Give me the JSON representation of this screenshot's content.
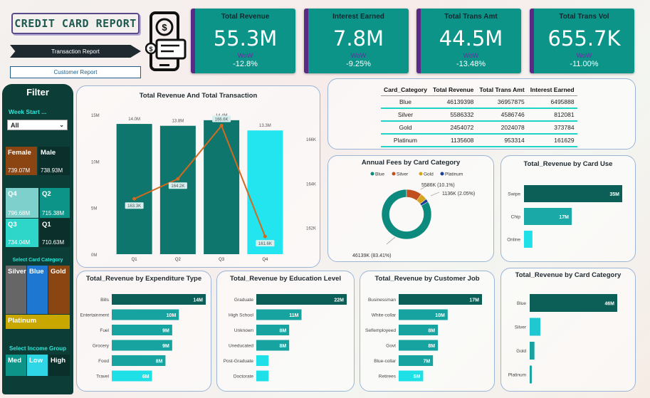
{
  "header": {
    "title": "CREDIT CARD REPORT",
    "nav_transaction": "Transaction Report",
    "nav_customer": "Customer Report",
    "logo_icon": "credit-card-refresh-icon"
  },
  "kpis": [
    {
      "title": "Total Revenue",
      "value": "55.3M",
      "wow": "WoW",
      "pct": "-12.8%"
    },
    {
      "title": "Interest Earned",
      "value": "7.8M",
      "wow": "WoW",
      "pct": "-9.25%"
    },
    {
      "title": "Total Trans Amt",
      "value": "44.5M",
      "wow": "WoW",
      "pct": "-13.48%"
    },
    {
      "title": "Total Trans Vol",
      "value": "655.7K",
      "wow": "WoW",
      "pct": "-11.00%"
    }
  ],
  "filter": {
    "title": "Filter",
    "week_label": "Week Start ...",
    "week_value": "All",
    "gender": [
      {
        "label": "Female",
        "value": "739.07M"
      },
      {
        "label": "Male",
        "value": "738.93M"
      }
    ],
    "quarters": [
      {
        "label": "Q4",
        "value": "796.68M"
      },
      {
        "label": "Q2",
        "value": "715.38M"
      },
      {
        "label": "Q3",
        "value": "734.04M"
      },
      {
        "label": "Q1",
        "value": "710.63M"
      }
    ],
    "card_cat_label": "Select Card Category",
    "card_cats": [
      "Silver",
      "Blue",
      "Gold",
      "Platinum"
    ],
    "income_label": "Select Income Group",
    "income": [
      "Med",
      "Low",
      "High"
    ]
  },
  "combo": {
    "title": "Total Revenue And Total Transaction",
    "left_ticks": [
      "15M",
      "10M",
      "5M",
      "0M"
    ],
    "right_ticks": [
      "166K",
      "164K",
      "162K"
    ],
    "bar_labels": [
      "14.0M",
      "13.8M",
      "14.4M",
      "13.3M"
    ],
    "line_labels": [
      "163.3K",
      "164.2K",
      "166.6K",
      "161.6K"
    ],
    "categories": [
      "Q1",
      "Q2",
      "Q3",
      "Q4"
    ]
  },
  "table": {
    "headers": [
      "Card_Category",
      "Total Revenue",
      "Total Trans Amt",
      "Interest Earned"
    ],
    "rows": [
      [
        "Blue",
        "46139398",
        "36957875",
        "6495888"
      ],
      [
        "Silver",
        "5586332",
        "4586746",
        "812081"
      ],
      [
        "Gold",
        "2454072",
        "2024078",
        "373784"
      ],
      [
        "Platinum",
        "1135608",
        "953314",
        "161629"
      ]
    ]
  },
  "donut": {
    "title": "Annual Fees by Card Category",
    "legend": [
      "Blue",
      "Silver",
      "Gold",
      "Platinum"
    ],
    "labels": [
      "5586K (10.1%)",
      "1136K (2.05%)",
      "46139K (83.41%)"
    ]
  },
  "card_use": {
    "title": "Total_Revenue by Card Use",
    "categories": [
      "Swipe",
      "Chip",
      "Online"
    ],
    "labels": [
      "35M",
      "17M",
      ""
    ]
  },
  "expenditure": {
    "title": "Total_Revenue by Expenditure Type",
    "categories": [
      "Bills",
      "Entertainment",
      "Fuel",
      "Grocery",
      "Food",
      "Travel"
    ],
    "labels": [
      "14M",
      "10M",
      "9M",
      "9M",
      "8M",
      "6M"
    ]
  },
  "education": {
    "title": "Total_Revenue by Education Level",
    "categories": [
      "Graduate",
      "High School",
      "Unknown",
      "Uneducated",
      "Post-Graduate",
      "Doctorate"
    ],
    "labels": [
      "22M",
      "11M",
      "8M",
      "8M",
      "",
      ""
    ]
  },
  "job": {
    "title": "Total_Revenue by Customer Job",
    "categories": [
      "Businessman",
      "White-collar",
      "Selfemployeed",
      "Govt",
      "Blue-collar",
      "Retirees"
    ],
    "labels": [
      "17M",
      "10M",
      "8M",
      "8M",
      "7M",
      "5M"
    ]
  },
  "card_category": {
    "title": "Total_Revenue by Card Category",
    "categories": [
      "Blue",
      "Silver",
      "Gold",
      "Platinum"
    ],
    "labels": [
      "46M",
      "",
      "",
      ""
    ]
  },
  "chart_data": [
    {
      "type": "bar",
      "title": "Total Revenue And Total Transaction",
      "categories": [
        "Q1",
        "Q2",
        "Q3",
        "Q4"
      ],
      "series": [
        {
          "values": [
            14.0,
            13.8,
            14.4,
            13.3
          ]
        },
        {
          "values": [
            163.3,
            164.2,
            166.6,
            161.6
          ]
        }
      ],
      "ylim": [
        0,
        15
      ]
    },
    {
      "type": "pie",
      "title": "Annual Fees by Card Category",
      "categories": [
        "Blue",
        "Silver",
        "Gold",
        "Platinum"
      ],
      "values": [
        46139,
        5586,
        2454,
        1136
      ]
    },
    {
      "type": "bar",
      "title": "Total_Revenue by Card Use",
      "categories": [
        "Swipe",
        "Chip",
        "Online"
      ],
      "values": [
        35,
        17,
        3
      ]
    },
    {
      "type": "bar",
      "title": "Total_Revenue by Expenditure Type",
      "categories": [
        "Bills",
        "Entertainment",
        "Fuel",
        "Grocery",
        "Food",
        "Travel"
      ],
      "values": [
        14,
        10,
        9,
        9,
        8,
        6
      ]
    },
    {
      "type": "bar",
      "title": "Total_Revenue by Education Level",
      "categories": [
        "Graduate",
        "High School",
        "Unknown",
        "Uneducated",
        "Post-Graduate",
        "Doctorate"
      ],
      "values": [
        22,
        11,
        8,
        8,
        3,
        3
      ]
    },
    {
      "type": "bar",
      "title": "Total_Revenue by Customer Job",
      "categories": [
        "Businessman",
        "White-collar",
        "Selfemployeed",
        "Govt",
        "Blue-collar",
        "Retirees"
      ],
      "values": [
        17,
        10,
        8,
        8,
        7,
        5
      ]
    },
    {
      "type": "bar",
      "title": "Total_Revenue by Card Category",
      "categories": [
        "Blue",
        "Silver",
        "Gold",
        "Platinum"
      ],
      "values": [
        46,
        5.6,
        2.5,
        1.1
      ]
    }
  ],
  "colors": {
    "teal": "#0d9488",
    "dark_teal": "#0f5f57",
    "cyan": "#18e0e0",
    "light_teal": "#1ab5b0",
    "orange": "#d2691e",
    "purple": "#5b2a86"
  }
}
